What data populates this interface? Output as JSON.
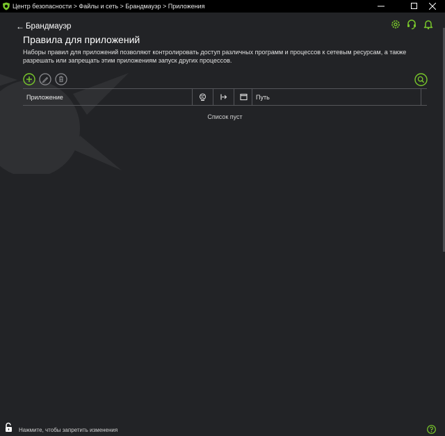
{
  "window": {
    "title": "Центр безопасности > Файлы и сеть > Брандмауэр > Приложения"
  },
  "nav": {
    "back_label": "Брандмауэр"
  },
  "page": {
    "title": "Правила для приложений",
    "description": "Наборы правил для приложений позволяют контролировать доступ различных программ и процессов к сетевым ресурсам, а также разрешать или запрещать этим приложениям запуск других процессов."
  },
  "table": {
    "columns": [
      {
        "label": "Приложение"
      },
      {
        "label": "",
        "icon": "globe-icon"
      },
      {
        "label": "",
        "icon": "launch-arrow-icon"
      },
      {
        "label": "",
        "icon": "window-icon"
      },
      {
        "label": "Путь"
      }
    ],
    "empty_text": "Список пуст"
  },
  "footer": {
    "lock_text": "Нажмите, чтобы запретить изменения"
  },
  "colors": {
    "accent": "#79c72b",
    "background": "#222326",
    "titlebar": "#000000",
    "divider": "#55565a"
  },
  "icons": [
    "app-shield-icon",
    "gear-icon",
    "support-headset-icon",
    "bell-icon",
    "add-icon",
    "edit-icon",
    "delete-icon",
    "search-icon",
    "lock-icon",
    "help-icon"
  ]
}
